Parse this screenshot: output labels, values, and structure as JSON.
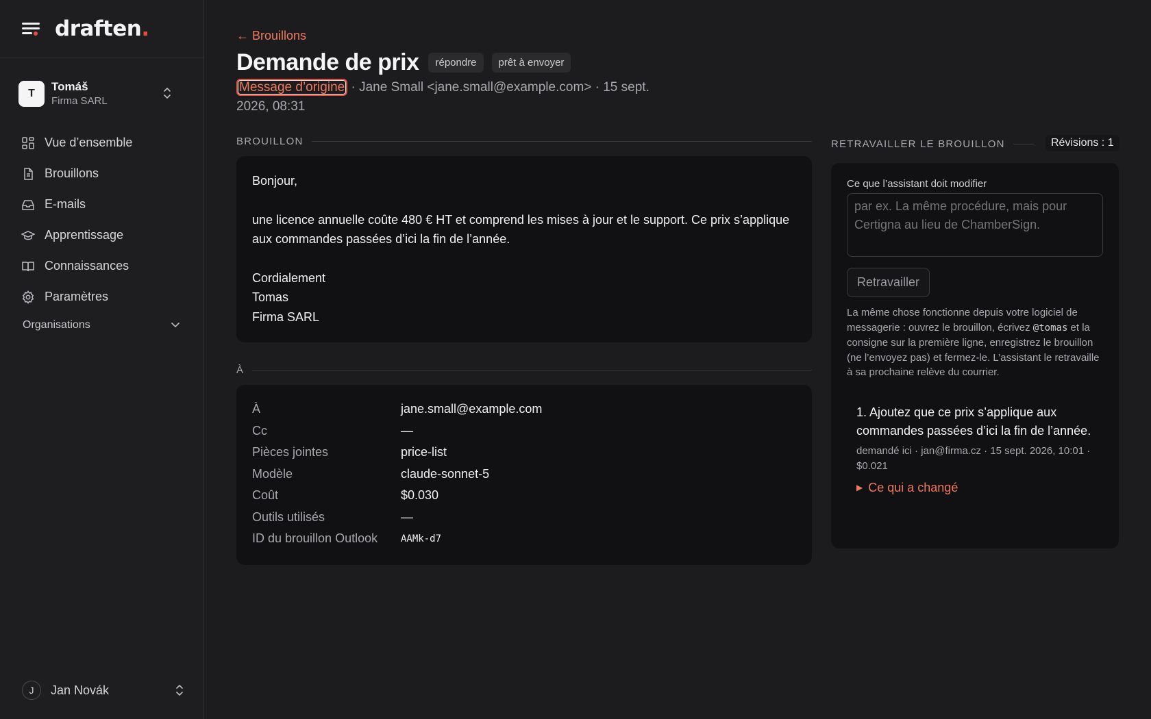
{
  "brand": {
    "name": "draften",
    "dot": "."
  },
  "account": {
    "initial": "T",
    "name": "Tomáš",
    "org": "Firma SARL"
  },
  "nav": [
    {
      "label": "Vue d’ensemble",
      "icon": "grid-icon"
    },
    {
      "label": "Brouillons",
      "icon": "document-icon"
    },
    {
      "label": "E-mails",
      "icon": "inbox-icon"
    },
    {
      "label": "Apprentissage",
      "icon": "graduation-cap-icon"
    },
    {
      "label": "Connaissances",
      "icon": "book-icon"
    },
    {
      "label": "Paramètres",
      "icon": "gear-icon"
    }
  ],
  "orgs_label": "Organisations",
  "user": {
    "initial": "J",
    "name": "Jan Novák"
  },
  "page": {
    "back_label": "← Brouillons",
    "title": "Demande de prix",
    "chips": [
      "répondre",
      "prêt à envoyer"
    ],
    "origin_link": "Message d’origine",
    "meta_rest": " · Jane Small <jane.small@example.com> · 15 sept. 2026, 08:31"
  },
  "draft": {
    "section": "BROUILLON",
    "greeting": "Bonjour,",
    "body": "une licence annuelle coûte 480 € HT et comprend les mises à jour et le support. Ce prix s’applique aux commandes passées d’ici la fin de l’année.",
    "closing": "Cordialement",
    "sig_name": "Tomas",
    "sig_org": "Firma SARL"
  },
  "details": {
    "section": "À",
    "rows": [
      {
        "k": "À",
        "v": "jane.small@example.com"
      },
      {
        "k": "Cc",
        "v": "—"
      },
      {
        "k": "Pièces jointes",
        "v": "price-list"
      },
      {
        "k": "Modèle",
        "v": "claude-sonnet-5"
      },
      {
        "k": "Coût",
        "v": "$0.030"
      },
      {
        "k": "Outils utilisés",
        "v": "—"
      },
      {
        "k": "ID du brouillon Outlook",
        "v": "AAMk-d7"
      }
    ]
  },
  "rework": {
    "section": "RETRAVAILLER LE BROUILLON",
    "revisions": "Révisions : 1",
    "field_label": "Ce que l’assistant doit modifier",
    "placeholder": "par ex. La même procédure, mais pour Certigna au lieu de ChamberSign.",
    "button": "Retravailler",
    "help_1": "La même chose fonctionne depuis votre logiciel de messagerie : ouvrez le brouillon, écrivez ",
    "help_code": "@tomas",
    "help_2": " et la consigne sur la première ligne, enregistrez le brouillon (ne l’envoyez pas) et fermez-le. L’assistant le retravaille à sa prochaine relève du courrier.",
    "item_text": "1. Ajoutez que ce prix s’applique aux commandes passées d’ici la fin de l’année.",
    "item_meta": "demandé ici · jan@firma.cz · 15 sept. 2026, 10:01 · $0.021",
    "item_changes": "Ce qui a changé"
  },
  "colors": {
    "accent": "#ee7a5e",
    "brand_dot": "#e2503d",
    "bg": "#1c1c1e",
    "card": "#111113"
  }
}
